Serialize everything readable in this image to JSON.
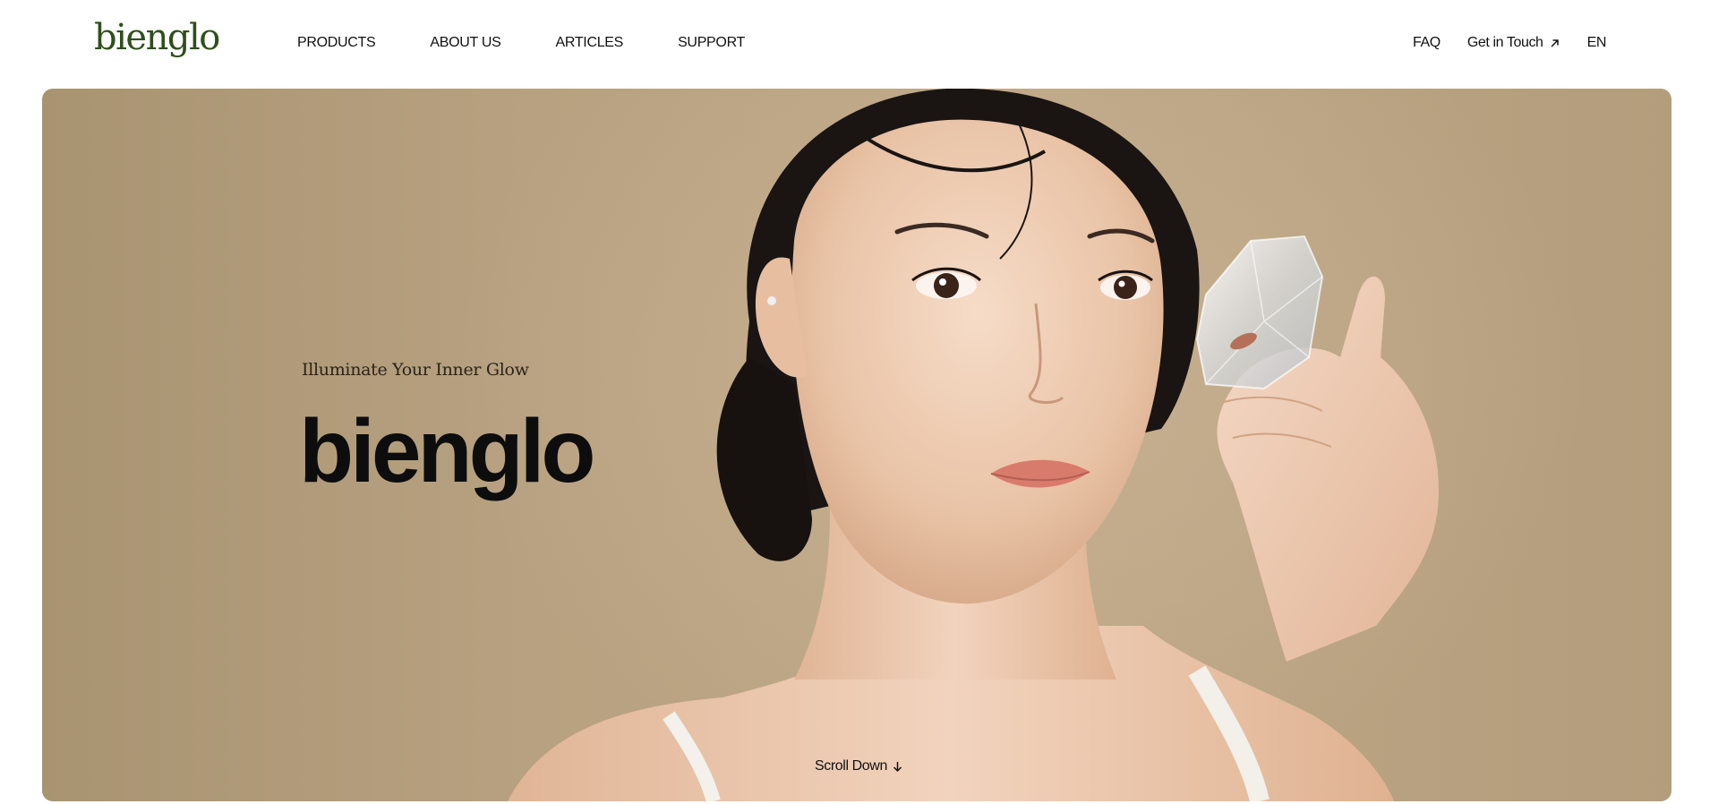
{
  "header": {
    "logo_text": "bienglo",
    "nav": [
      "PRODUCTS",
      "ABOUT US",
      "ARTICLES",
      "SUPPORT"
    ],
    "right": {
      "faq": "FAQ",
      "get_in_touch": "Get in Touch",
      "language": "EN"
    }
  },
  "hero": {
    "tagline": "Illuminate Your Inner Glow",
    "title": "bienglo",
    "scroll_label": "Scroll Down"
  },
  "colors": {
    "brand_green": "#2f4f1a",
    "hero_background": "#b7a180",
    "text_dark": "#111111"
  },
  "icons": {
    "get_in_touch_icon": "arrow-up-right-icon",
    "scroll_icon": "arrow-down-icon"
  }
}
